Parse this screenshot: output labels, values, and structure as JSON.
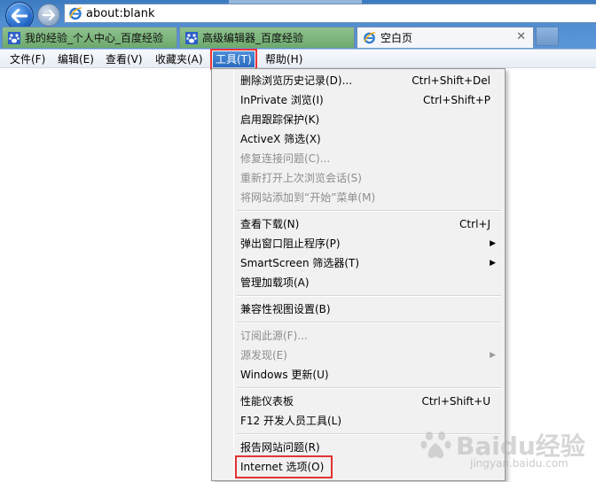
{
  "address": {
    "url": "about:blank"
  },
  "tabs": [
    {
      "label": "我的经验_个人中心_百度经验",
      "active": false
    },
    {
      "label": "高级编辑器_百度经验",
      "active": false
    },
    {
      "label": "空白页",
      "active": true
    }
  ],
  "tab_close_glyph": "✕",
  "menu": [
    "文件(F)",
    "编辑(E)",
    "查看(V)",
    "收藏夹(A)",
    "工具(T)",
    "帮助(H)"
  ],
  "open_menu_index": 4,
  "dropdown": {
    "groups": [
      [
        {
          "label": "删除浏览历史记录(D)...",
          "shortcut": "Ctrl+Shift+Del",
          "enabled": true
        },
        {
          "label": "InPrivate 浏览(I)",
          "shortcut": "Ctrl+Shift+P",
          "enabled": true
        },
        {
          "label": "启用跟踪保护(K)",
          "shortcut": "",
          "enabled": true
        },
        {
          "label": "ActiveX 筛选(X)",
          "shortcut": "",
          "enabled": true
        },
        {
          "label": "修复连接问题(C)...",
          "shortcut": "",
          "enabled": false
        },
        {
          "label": "重新打开上次浏览会话(S)",
          "shortcut": "",
          "enabled": false
        },
        {
          "label": "将网站添加到“开始”菜单(M)",
          "shortcut": "",
          "enabled": false
        }
      ],
      [
        {
          "label": "查看下载(N)",
          "shortcut": "Ctrl+J",
          "enabled": true
        },
        {
          "label": "弹出窗口阻止程序(P)",
          "shortcut": "",
          "enabled": true,
          "submenu": true
        },
        {
          "label": "SmartScreen 筛选器(T)",
          "shortcut": "",
          "enabled": true,
          "submenu": true
        },
        {
          "label": "管理加载项(A)",
          "shortcut": "",
          "enabled": true
        }
      ],
      [
        {
          "label": "兼容性视图设置(B)",
          "shortcut": "",
          "enabled": true
        }
      ],
      [
        {
          "label": "订阅此源(F)...",
          "shortcut": "",
          "enabled": false
        },
        {
          "label": "源发现(E)",
          "shortcut": "",
          "enabled": false,
          "submenu": true
        },
        {
          "label": "Windows 更新(U)",
          "shortcut": "",
          "enabled": true
        }
      ],
      [
        {
          "label": "性能仪表板",
          "shortcut": "Ctrl+Shift+U",
          "enabled": true
        },
        {
          "label": "F12 开发人员工具(L)",
          "shortcut": "",
          "enabled": true
        }
      ],
      [
        {
          "label": "报告网站问题(R)",
          "shortcut": "",
          "enabled": true
        },
        {
          "label": "Internet 选项(O)",
          "shortcut": "",
          "enabled": true,
          "highlighted": true
        }
      ]
    ]
  },
  "submenu_arrow": "▶",
  "colors": {
    "highlight_border": "#e33333",
    "disabled_text": "#8d8d8d"
  },
  "watermark": {
    "brand": "Baidu经验",
    "sub": "jingyan.baidu.com"
  }
}
